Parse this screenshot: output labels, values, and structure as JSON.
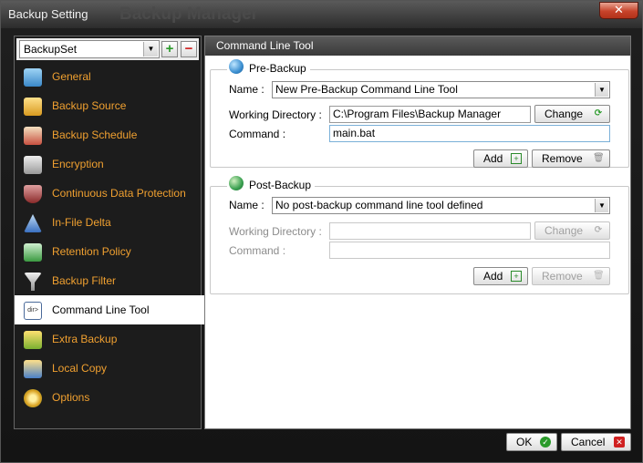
{
  "window": {
    "title": "Backup Setting",
    "background_title": "Backup Manager",
    "close_glyph": "✕"
  },
  "sidebar": {
    "backup_set": "BackupSet",
    "add_glyph": "+",
    "remove_glyph": "−",
    "items": [
      {
        "label": "General",
        "icon": "general-icon",
        "color": "#4aa0d8"
      },
      {
        "label": "Backup Source",
        "icon": "folder-open-icon",
        "color": "#e8b030"
      },
      {
        "label": "Backup Schedule",
        "icon": "calendar-icon",
        "color": "#d05050"
      },
      {
        "label": "Encryption",
        "icon": "key-icon",
        "color": "#c8c8c8"
      },
      {
        "label": "Continuous Data Protection",
        "icon": "shield-icon",
        "color": "#b04040"
      },
      {
        "label": "In-File Delta",
        "icon": "delta-icon",
        "color": "#3a78c8"
      },
      {
        "label": "Retention Policy",
        "icon": "recycle-icon",
        "color": "#3aa040"
      },
      {
        "label": "Backup Filter",
        "icon": "filter-icon",
        "color": "#a0a0a0"
      },
      {
        "label": "Command Line Tool",
        "icon": "terminal-icon",
        "color": "#ffffff"
      },
      {
        "label": "Extra Backup",
        "icon": "extra-backup-icon",
        "color": "#e8b030"
      },
      {
        "label": "Local Copy",
        "icon": "local-copy-icon",
        "color": "#e8b030"
      },
      {
        "label": "Options",
        "icon": "gear-icon",
        "color": "#e8b030"
      }
    ],
    "active_index": 8
  },
  "main": {
    "header": "Command Line Tool",
    "pre_backup": {
      "title": "Pre-Backup",
      "name_label": "Name :",
      "name_value": "New Pre-Backup Command Line Tool",
      "workdir_label": "Working Directory :",
      "workdir_value": "C:\\Program Files\\Backup Manager",
      "change_label": "Change",
      "command_label": "Command :",
      "command_value": "main.bat",
      "add_label": "Add",
      "remove_label": "Remove"
    },
    "post_backup": {
      "title": "Post-Backup",
      "name_label": "Name :",
      "name_value": "No post-backup command line tool defined",
      "workdir_label": "Working Directory :",
      "workdir_value": "",
      "change_label": "Change",
      "command_label": "Command :",
      "command_value": "",
      "add_label": "Add",
      "remove_label": "Remove"
    }
  },
  "footer": {
    "ok_label": "OK",
    "cancel_label": "Cancel"
  },
  "colors": {
    "accent_orange": "#f0a030",
    "ok_green": "#2a9a2a",
    "cancel_red": "#d02020"
  }
}
